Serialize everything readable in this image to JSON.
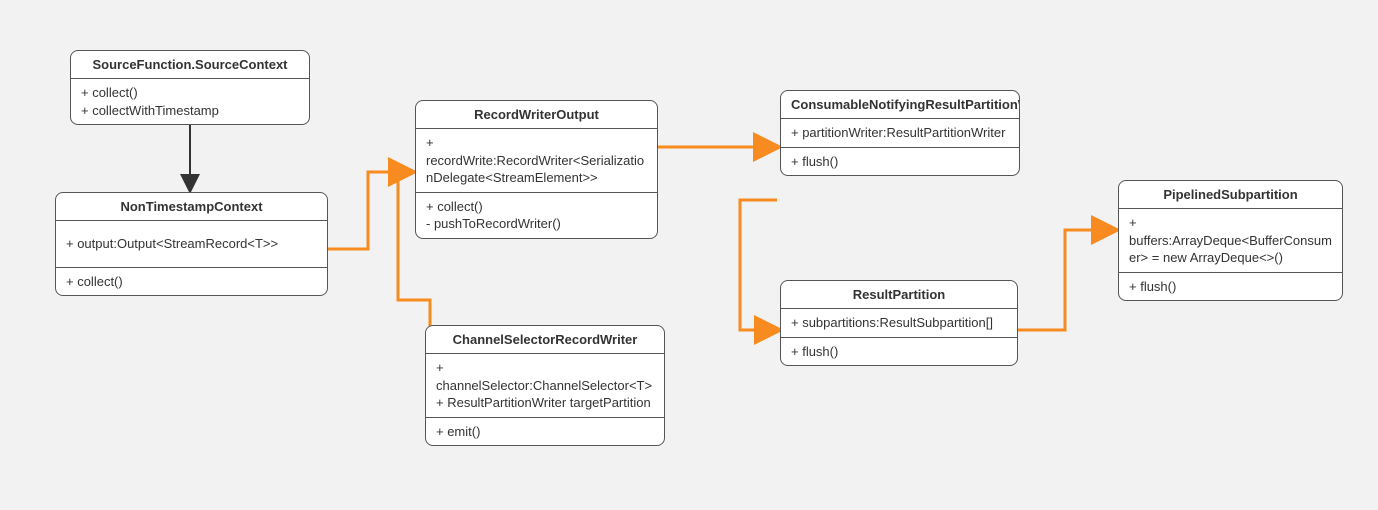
{
  "boxes": {
    "sourceContext": {
      "title": "SourceFunction.SourceContext",
      "members": "+ collect()\n+ collectWithTimestamp"
    },
    "nonTimestampContext": {
      "title": "NonTimestampContext",
      "members": "+ output:Output<StreamRecord<T>>",
      "methods": "+ collect()"
    },
    "recordWriterOutput": {
      "title": "RecordWriterOutput",
      "members": "+ recordWrite:RecordWriter<SerializationDelegate<StreamElement>>",
      "methods": "+ collect()\n- pushToRecordWriter()"
    },
    "channelSelectorRecordWriter": {
      "title": "ChannelSelectorRecordWriter",
      "members": "+ channelSelector:ChannelSelector<T>\n+ ResultPartitionWriter targetPartition",
      "methods": "+ emit()"
    },
    "consumableDecorator": {
      "title": "ConsumableNotifyingResultPartitionWriterDecorator",
      "members": "+ partitionWriter:ResultPartitionWriter",
      "methods": "+ flush()"
    },
    "resultPartition": {
      "title": "ResultPartition",
      "members": "+ subpartitions:ResultSubpartition[]",
      "methods": "+ flush()"
    },
    "pipelinedSubpartition": {
      "title": "PipelinedSubpartition",
      "members": "+ buffers:ArrayDeque<BufferConsumer> = new ArrayDeque<>()",
      "methods": "+ flush()"
    }
  }
}
